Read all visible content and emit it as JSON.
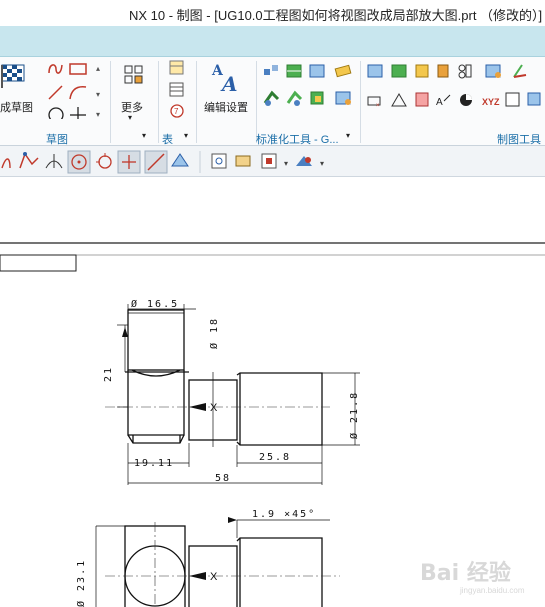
{
  "window": {
    "title": "NX 10 - 制图 - [UG10.0工程图如何将视图改成局部放大图.prt （修改的）]"
  },
  "ribbon": {
    "sketch_button_label": "成草图",
    "more_label": "更多",
    "edit_settings_label": "编辑设置",
    "groups": {
      "sketch": "草图",
      "table": "表",
      "std_tools": "标准化工具 - G...",
      "drafting_tools": "制图工具"
    },
    "xyz_label": "XYZ"
  },
  "drawing": {
    "dims": {
      "d_16_5": "Ø 16.5",
      "d_18": "Ø 18",
      "d_21_8": "Ø 21.8",
      "len_21": "21",
      "len_19_11": "19.11",
      "len_25_8": "25.8",
      "len_58": "58",
      "chamfer": "1.9 ×45°",
      "d_23_1": "Ø 23.1"
    },
    "x_marker": "X"
  },
  "watermark": {
    "text": "Bai 经验",
    "sub": "jingyan.baidu.com"
  }
}
